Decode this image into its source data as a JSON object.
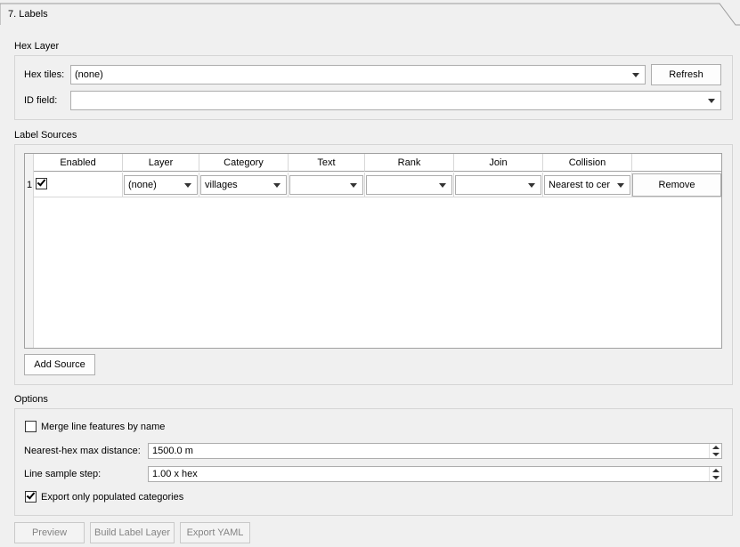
{
  "tab": {
    "label": "7. Labels"
  },
  "hex_layer": {
    "title": "Hex Layer",
    "hex_tiles_label": "Hex tiles:",
    "hex_tiles_value": "(none)",
    "refresh_label": "Refresh",
    "id_field_label": "ID field:",
    "id_field_value": ""
  },
  "label_sources": {
    "title": "Label Sources",
    "columns": [
      "Enabled",
      "Layer",
      "Category",
      "Text",
      "Rank",
      "Join",
      "Collision",
      ""
    ],
    "rows": [
      {
        "row_number": "1",
        "enabled": true,
        "layer": "(none)",
        "category": "villages",
        "text": "",
        "rank": "",
        "join": "",
        "collision": "Nearest to cer",
        "remove_label": "Remove"
      }
    ],
    "add_source_label": "Add Source"
  },
  "options": {
    "title": "Options",
    "merge_label": "Merge line features by name",
    "merge_checked": false,
    "nearest_label": "Nearest-hex max distance:",
    "nearest_value": "1500.0 m",
    "sample_label": "Line sample step:",
    "sample_value": "1.00 x hex",
    "export_only_label": "Export only populated categories",
    "export_only_checked": true
  },
  "footer": {
    "preview_label": "Preview",
    "build_label": "Build Label Layer",
    "export_yaml_label": "Export YAML"
  }
}
